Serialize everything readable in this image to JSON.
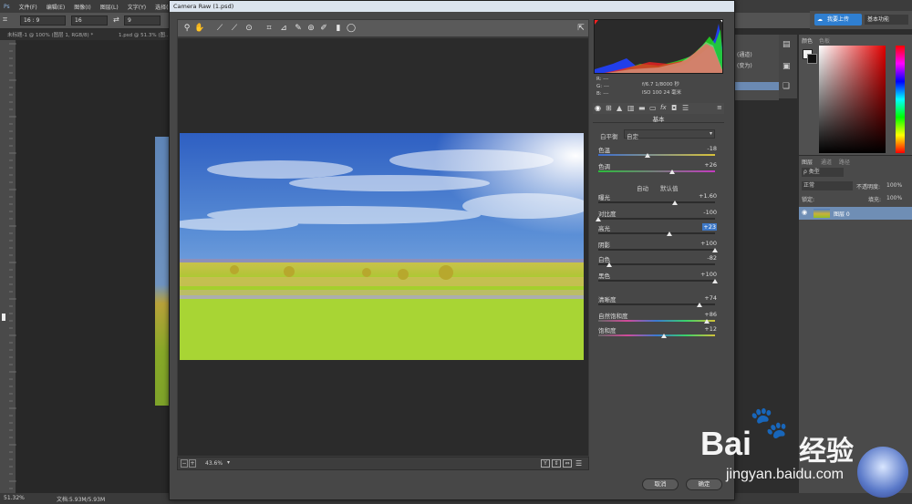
{
  "menubar": {
    "items": [
      "文件(F)",
      "编辑(E)",
      "图像(I)",
      "图层(L)",
      "文字(Y)",
      "选择(S)"
    ]
  },
  "options": {
    "ratio": "16 : 9",
    "w": "16",
    "h": "9"
  },
  "doc_tabs": [
    "未标题-1 @ 100% (图层 1, RGB/8) *",
    "1.psd @ 51.3% (图..."
  ],
  "statusbar": {
    "zoom": "51.32%",
    "docsize": "文档:5.93M/5.93M"
  },
  "ps_right": {
    "cloud_btn": "我要上传",
    "workspace": "基本功能",
    "hist_lines": [
      "(通道)",
      "(变为)"
    ],
    "color_tabs": [
      "颜色",
      "色板"
    ],
    "layer_tabs": [
      "图层",
      "通道",
      "路径"
    ],
    "kind": "ρ 类型",
    "blend": "正常",
    "opacity_label": "不透明度:",
    "opacity": "100%",
    "lock_label": "锁定:",
    "fill_label": "填充:",
    "fill": "100%",
    "layer_name": "图层 0"
  },
  "cr": {
    "title": "Camera Raw (1.psd)",
    "zoom": "43.6%",
    "readout": {
      "r": "R: ---",
      "g": "G: ---",
      "b": "B: ---",
      "f": "f/6.7   1/8000 秒",
      "iso": "ISO 100   24 毫米"
    },
    "section": "基本",
    "wb_label": "白平衡",
    "wb_value": "自定",
    "auto": "自动",
    "default": "默认值",
    "sliders": [
      {
        "label": "色温",
        "value": "-18",
        "pos": 0.42
      },
      {
        "label": "色调",
        "value": "+26",
        "pos": 0.63
      },
      {
        "label": "曝光",
        "value": "+1.60",
        "pos": 0.66
      },
      {
        "label": "对比度",
        "value": "-100",
        "pos": 0.0
      },
      {
        "label": "高光",
        "value": "+23",
        "pos": 0.61
      },
      {
        "label": "阴影",
        "value": "+100",
        "pos": 1.0
      },
      {
        "label": "白色",
        "value": "-82",
        "pos": 0.09
      },
      {
        "label": "黑色",
        "value": "+100",
        "pos": 1.0
      },
      {
        "label": "清晰度",
        "value": "+74",
        "pos": 0.87
      },
      {
        "label": "自然饱和度",
        "value": "+86",
        "pos": 0.93
      },
      {
        "label": "饱和度",
        "value": "+12",
        "pos": 0.56
      }
    ],
    "cancel": "取消",
    "ok": "确定"
  },
  "watermark": {
    "brand": "Bai",
    "brand2": "经验",
    "url": "jingyan.baidu.com"
  },
  "colors": {
    "accent": "#3e78c6",
    "sky": "#3f72c9",
    "grass": "#9ecb2a"
  }
}
